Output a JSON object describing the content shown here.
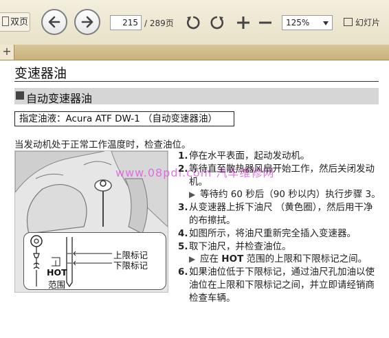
{
  "toolbar": {
    "page_mode_label": "双页",
    "back_icon": "arrow-left-icon",
    "forward_icon": "arrow-right-icon",
    "current_page": "215",
    "total_pages": "/ 289页",
    "rotate_left_icon": "rotate-ccw-icon",
    "rotate_right_icon": "rotate-cw-icon",
    "zoom_in_icon": "plus-icon",
    "zoom_out_icon": "minus-icon",
    "zoom_value": "125%",
    "slideshow_label": "幻灯片"
  },
  "tabs": {
    "add_label": "+"
  },
  "document": {
    "title": "变速器油",
    "section_title": "自动变速器油",
    "fluid_spec": "指定油液：Acura ATF DW-1 （自动变速器油）",
    "intro": "当发动机处于正常工作温度时，检查油位。",
    "illustration": {
      "upper_mark": "上限标记",
      "lower_mark": "下限标记",
      "hot": "HOT",
      "range": "范围"
    },
    "watermark": "www.08pdf.com 汽车维修网",
    "steps": [
      {
        "num": "1.",
        "text": "停在水平表面，起动发动机。"
      },
      {
        "num": "2.",
        "text": "等待直至散热器风扇开始工作，然后关闭发动机。",
        "sub": "等待约 60 秒后（90 秒以内）执行步骤 3。"
      },
      {
        "num": "3.",
        "text": "从变速器上拆下油尺 （黄色圈），然后用干净的布擦拭。"
      },
      {
        "num": "4.",
        "text": "如图所示，将油尺重新完全插入变速器。"
      },
      {
        "num": "5.",
        "text": "取下油尺，并检查油位。",
        "sub_pre": "应在 ",
        "sub_bold": "HOT",
        "sub_post": " 范围的上限和下限标记之间。"
      },
      {
        "num": "6.",
        "text": "如果油位低于下限标记，通过油尺孔加油以使油位在上限和下限标记之间，并立即请经销商检查车辆。"
      }
    ]
  },
  "colors": {
    "toolbar_bg": "#ece6d0",
    "tabbar_bg": "#cdb784",
    "section_bar": "#d6d6d6",
    "watermark": "#e05ce0"
  }
}
